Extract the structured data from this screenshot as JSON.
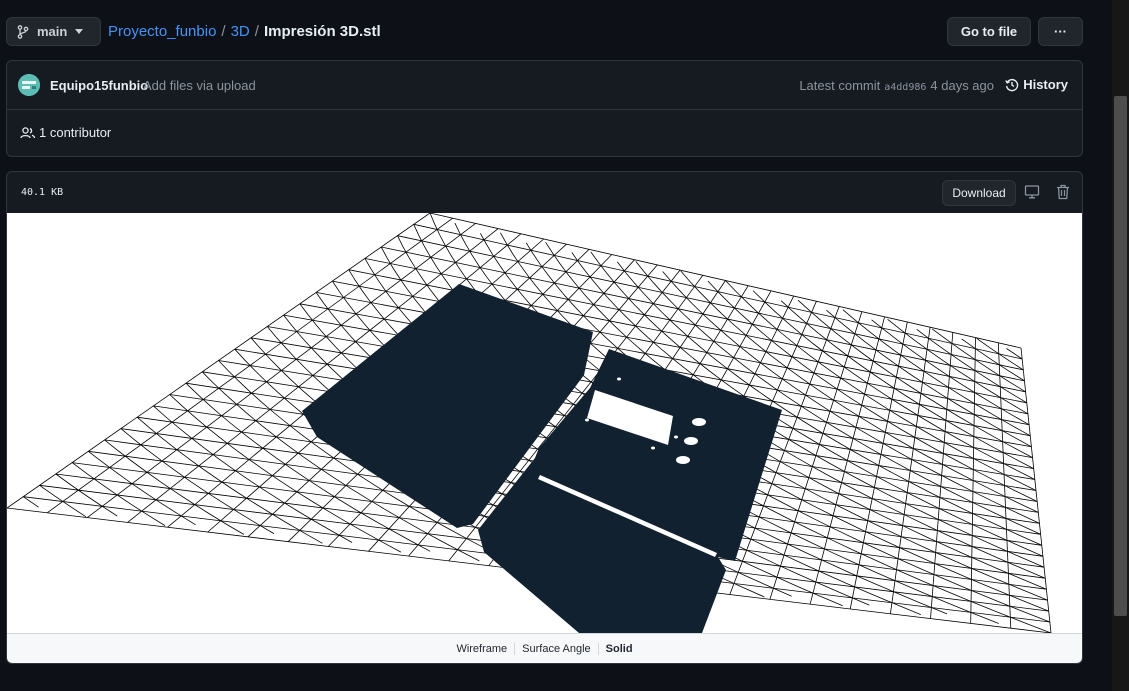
{
  "header": {
    "branch": "main",
    "breadcrumb": {
      "repo": "Proyecto_funbio",
      "sep1": "/",
      "folder": "3D",
      "sep2": "/",
      "file": "Impresión 3D.stl"
    },
    "go_to_file": "Go to file",
    "more_options": "···"
  },
  "commit": {
    "author": "Equipo15funbio",
    "message": "Add files via upload",
    "latest_label": "Latest commit",
    "sha": "a4dd986",
    "age": "4 days ago",
    "history": "History",
    "contributors": "1 contributor"
  },
  "file": {
    "size": "40.1 KB",
    "download": "Download",
    "view_modes": [
      "Wireframe",
      "Surface Angle",
      "Solid"
    ],
    "active_view_mode": "Solid"
  },
  "colors": {
    "background": "#0d1117",
    "link": "#4493f8",
    "model_fill": "#11212f",
    "grid_line": "#000000",
    "viewer_background": "#ffffff"
  },
  "icons": {
    "branch": "git-branch-icon",
    "caret": "triangle-down-icon",
    "history": "history-icon",
    "people": "people-icon",
    "desktop": "desktop-icon",
    "trash": "trash-icon"
  }
}
